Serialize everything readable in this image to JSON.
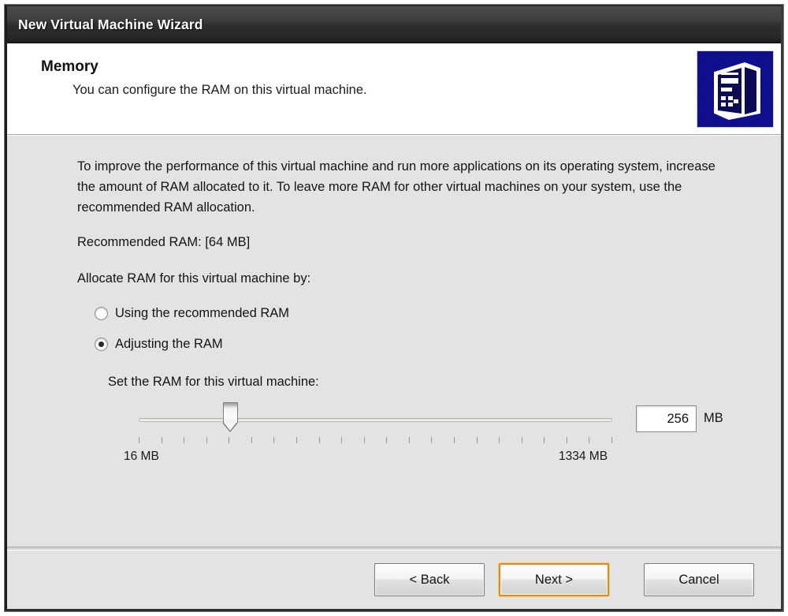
{
  "window": {
    "title": "New Virtual Machine Wizard"
  },
  "header": {
    "title": "Memory",
    "subtitle": "You can configure the RAM on this virtual machine.",
    "icon": "virtual-machine-icon"
  },
  "body": {
    "description": "To improve the performance of this virtual machine and run more applications on its operating system, increase the amount of RAM allocated to it. To leave more RAM for other virtual machines on your system, use the recommended RAM allocation.",
    "recommended_ram": "Recommended RAM: [64 MB]",
    "allocate_label": "Allocate RAM for this virtual machine by:",
    "options": [
      {
        "label": "Using the recommended RAM",
        "selected": false
      },
      {
        "label": "Adjusting the RAM",
        "selected": true
      }
    ],
    "slider": {
      "label": "Set the RAM for this virtual machine:",
      "min_label": "16 MB",
      "max_label": "1334 MB",
      "min": 16,
      "max": 1334,
      "value": 256,
      "tick_count": 22,
      "thumb_percent": 19.3
    },
    "ram_field": {
      "value": "256",
      "unit": "MB"
    }
  },
  "footer": {
    "buttons": [
      {
        "label": "< Back",
        "focused": false
      },
      {
        "label": "Next >",
        "focused": true
      },
      {
        "label": "Cancel",
        "focused": false
      }
    ]
  },
  "colors": {
    "titlebar_dark": "#2e2e2e",
    "body_gray": "#e3e3e3",
    "focus_orange": "#e08a18",
    "icon_blue": "#1414c8"
  }
}
